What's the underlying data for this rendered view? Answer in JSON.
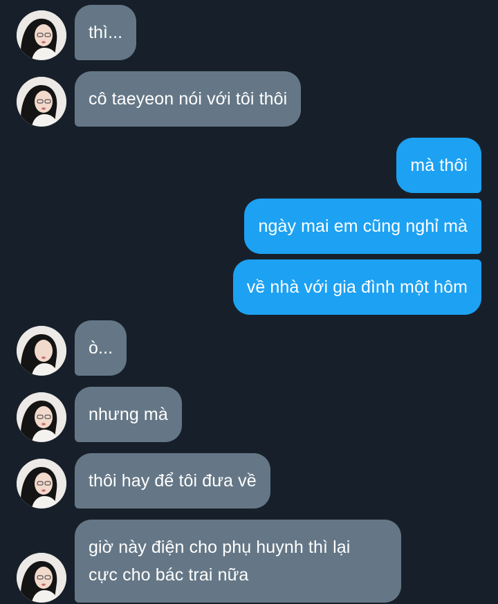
{
  "messages": [
    {
      "side": "in",
      "text": "thì..."
    },
    {
      "side": "in",
      "text": "cô taeyeon nói với tôi thôi"
    },
    {
      "side": "out",
      "text": "mà thôi"
    },
    {
      "side": "out",
      "text": "ngày mai em cũng nghỉ mà"
    },
    {
      "side": "out",
      "text": "về nhà với gia đình một hôm"
    },
    {
      "side": "in",
      "text": "ò..."
    },
    {
      "side": "in",
      "text": "nhưng mà"
    },
    {
      "side": "in",
      "text": "thôi hay để tôi đưa về"
    },
    {
      "side": "in",
      "text_line1": "giờ này điện cho phụ huynh thì lại",
      "text_line2": "cực cho bác trai nữa"
    }
  ],
  "colors": {
    "background": "#17202a",
    "incoming_bubble": "#657786",
    "outgoing_bubble": "#1da1f2",
    "text": "#ffffff"
  },
  "avatar_icon": "profile-photo-avatar"
}
